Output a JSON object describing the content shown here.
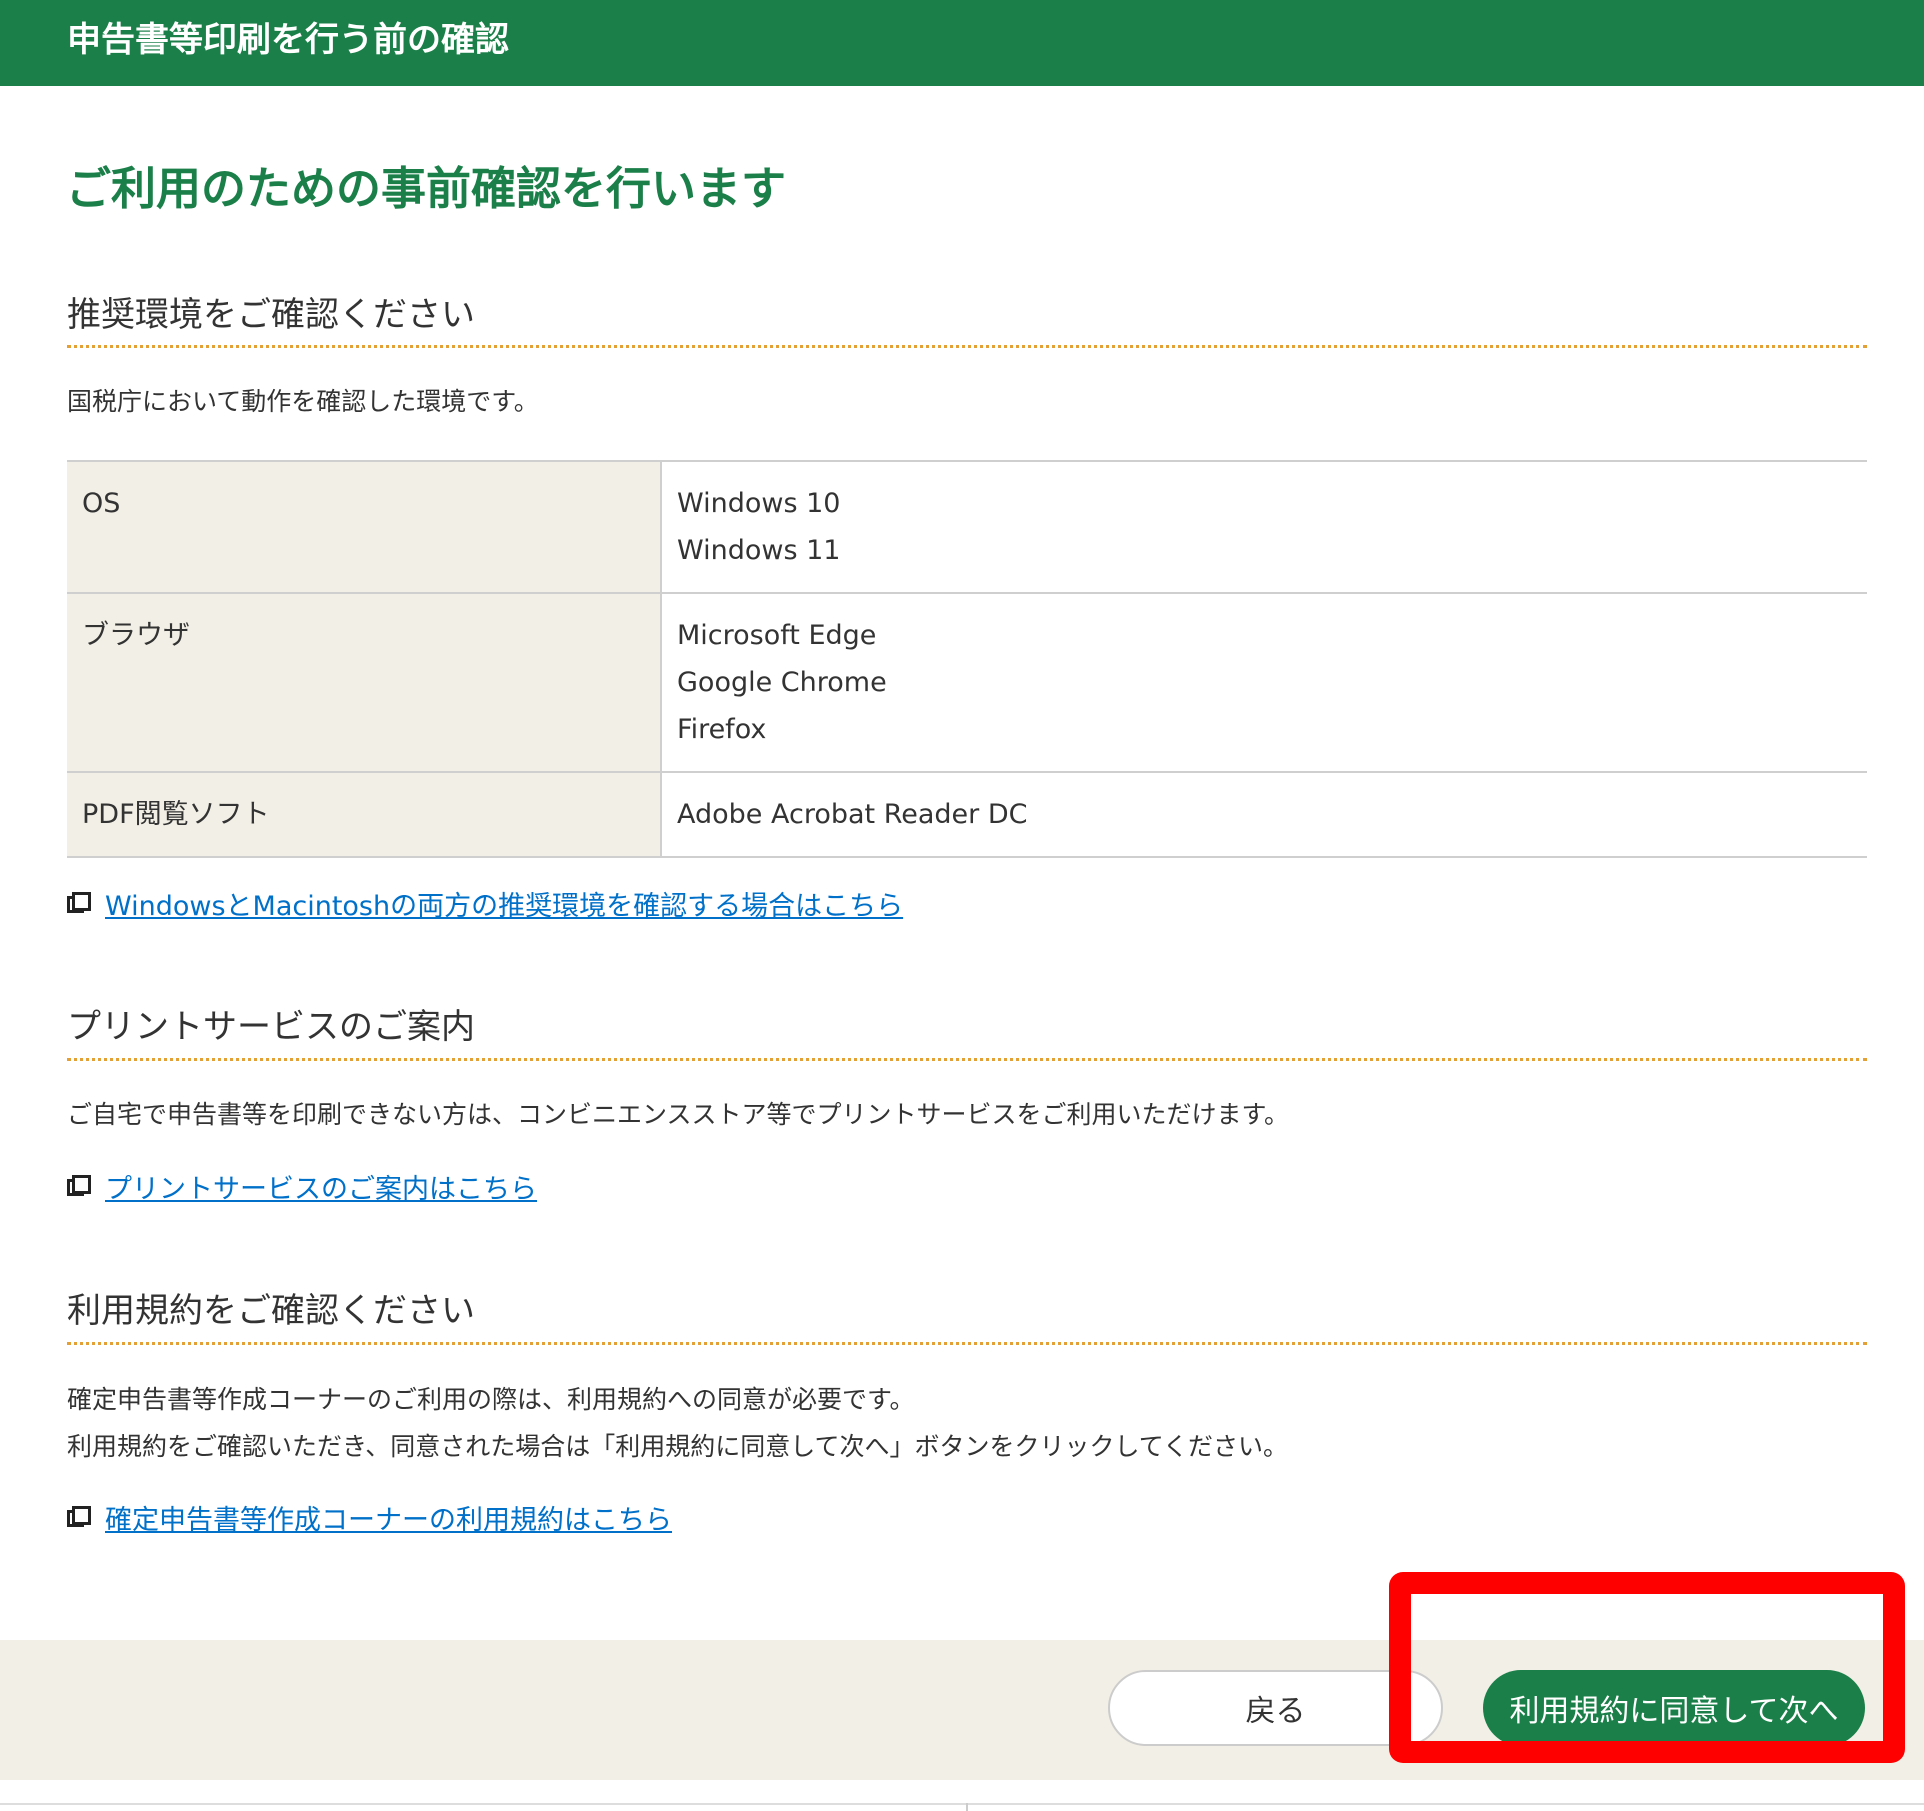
{
  "header": {
    "title": "申告書等印刷を行う前の確認"
  },
  "page": {
    "title": "ご利用のための事前確認を行います"
  },
  "recommended_env": {
    "heading": "推奨環境をご確認ください",
    "intro": "国税庁において動作を確認した環境です。",
    "table": {
      "rows": [
        {
          "label": "OS",
          "values": [
            "Windows 10",
            "Windows 11"
          ]
        },
        {
          "label": "ブラウザ",
          "values": [
            "Microsoft Edge",
            "Google Chrome",
            "Firefox"
          ]
        },
        {
          "label": "PDF閲覧ソフト",
          "values": [
            "Adobe Acrobat Reader DC"
          ]
        }
      ]
    },
    "link": "WindowsとMacintoshの両方の推奨環境を確認する場合はこちら"
  },
  "print_service": {
    "heading": "プリントサービスのご案内",
    "text": "ご自宅で申告書等を印刷できない方は、コンビニエンスストア等でプリントサービスをご利用いただけます。",
    "link": "プリントサービスのご案内はこちら"
  },
  "terms": {
    "heading": "利用規約をご確認ください",
    "text_line1": "確定申告書等作成コーナーのご利用の際は、利用規約への同意が必要です。",
    "text_line2": "利用規約をご確認いただき、同意された場合は「利用規約に同意して次へ」ボタンをクリックしてください。",
    "link": "確定申告書等作成コーナーの利用規約はこちら"
  },
  "footer": {
    "back_label": "戻る",
    "agree_label": "利用規約に同意して次へ"
  },
  "colors": {
    "brand_green": "#1b7f49",
    "heading_rule": "#e3a035",
    "link": "#0070c9",
    "table_label_bg": "#f2efe6",
    "highlight": "#ff0000"
  },
  "icons": {
    "external_link": "new-window-icon"
  }
}
